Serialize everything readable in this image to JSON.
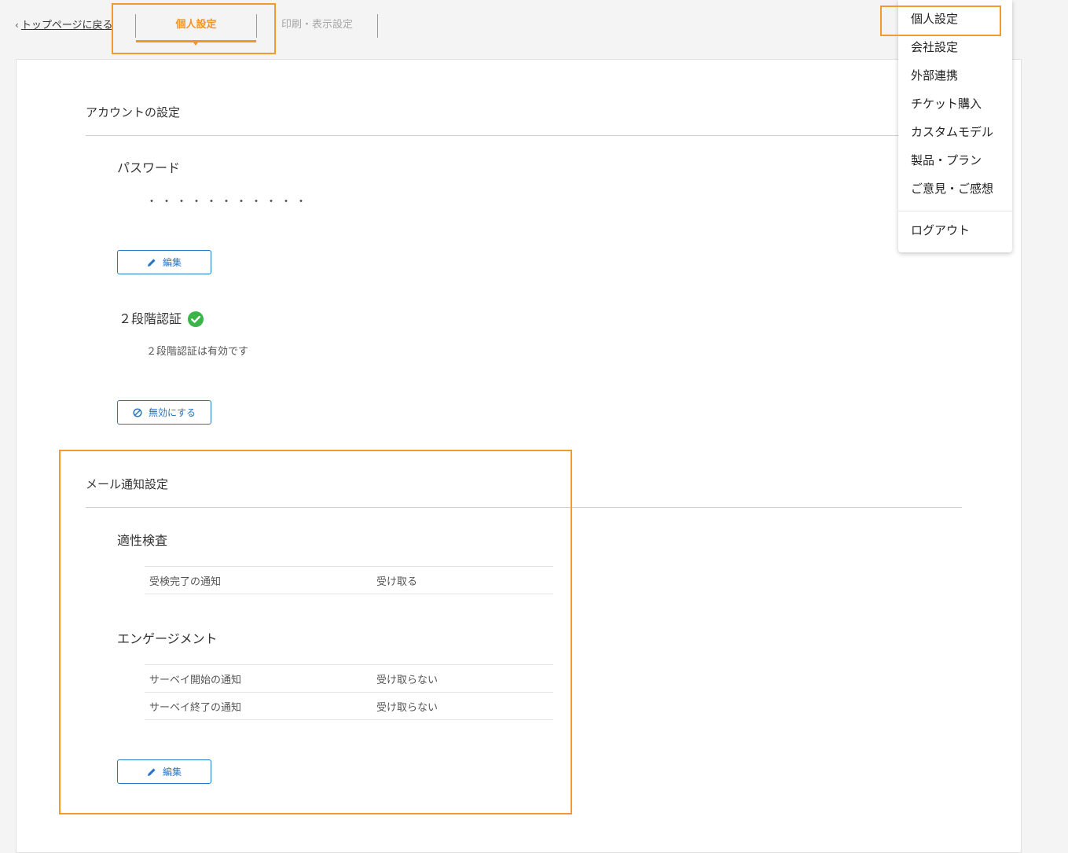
{
  "nav": {
    "back_link": "トップページに戻る",
    "back_chevron": "‹",
    "tabs": [
      {
        "label": "個人設定",
        "active": true
      },
      {
        "label": "印刷・表示設定",
        "active": false
      }
    ]
  },
  "account": {
    "title": "アカウントの設定",
    "password": {
      "label": "パスワード",
      "masked_value": "・・・・・・・・・・・",
      "edit_label": "編集"
    },
    "two_factor": {
      "label": "２段階認証",
      "status_text": "２段階認証は有効です",
      "disable_label": "無効にする"
    }
  },
  "mail": {
    "title": "メール通知設定",
    "groups": [
      {
        "title": "適性検査",
        "rows": [
          {
            "name": "受検完了の通知",
            "value": "受け取る"
          }
        ]
      },
      {
        "title": "エンゲージメント",
        "rows": [
          {
            "name": "サーベイ開始の通知",
            "value": "受け取らない"
          },
          {
            "name": "サーベイ終了の通知",
            "value": "受け取らない"
          }
        ]
      }
    ],
    "edit_label": "編集"
  },
  "menu": {
    "items": [
      "個人設定",
      "会社設定",
      "外部連携",
      "チケット購入",
      "カスタムモデル",
      "製品・プラン",
      "ご意見・ご感想"
    ],
    "logout": "ログアウト"
  },
  "colors": {
    "accent_orange": "#f0962a",
    "link_blue": "#2a74c4",
    "success_green": "#3bb54a"
  },
  "icons": {
    "edit": "pencil-icon",
    "disable": "prohibited-icon",
    "verified": "check-circle-icon"
  }
}
